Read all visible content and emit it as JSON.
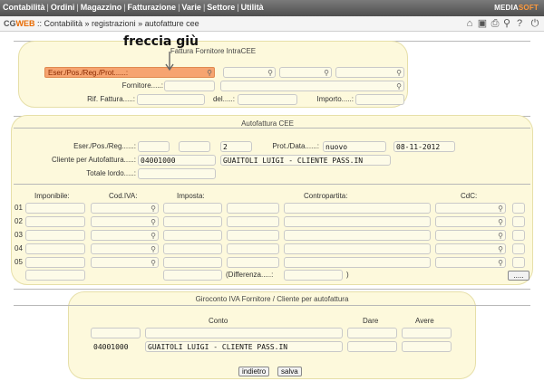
{
  "menu": [
    "Contabilità",
    "Ordini",
    "Magazzino",
    "Fatturazione",
    "Varie",
    "Settore",
    "Utilità"
  ],
  "brand": {
    "a": "MEDIA",
    "b": "SOFT"
  },
  "breadcrumb": {
    "app_a": "CG",
    "app_b": "WEB",
    "path": ":: Contabilità » registrazioni » autofatture cee"
  },
  "annotation": {
    "text": "freccia giù"
  },
  "section1": {
    "title": "Fattura Fornitore IntraCEE",
    "eser_label": "Eser./Pos./Reg./Prot......:",
    "fornitore_label": "Fornitore.....:",
    "rif_label": "Rif. Fattura.....:",
    "del_label": "del.....:",
    "importo_label": "Importo.....:"
  },
  "section2": {
    "title": "Autofattura CEE",
    "eser_label": "Eser./Pos./Reg......:",
    "reg_value": "2",
    "prot_label": "Prot./Data......:",
    "prot_value": "nuovo",
    "date_value": "08-11-2012",
    "cliente_label": "Cliente per Autofattura.....:",
    "cliente_code": "04001000",
    "cliente_name": "GUAITOLI LUIGI - CLIENTE PASS.IN",
    "totale_label": "Totale lordo.....:"
  },
  "grid": {
    "headers": {
      "imponibile": "Imponibile:",
      "cod_iva": "Cod.IVA:",
      "imposta": "Imposta:",
      "contropartita": "Contropartita:",
      "cdc": "CdC:"
    },
    "rows": [
      "01",
      "02",
      "03",
      "04",
      "05"
    ],
    "differenza_label": "(Differenza.....:",
    "paren_close": ")",
    "more_button": "....."
  },
  "section3": {
    "title": "Giroconto IVA Fornitore / Cliente per autofattura",
    "conto_label": "Conto",
    "dare_label": "Dare",
    "avere_label": "Avere",
    "conto_code": "04001000",
    "conto_name": "GUAITOLI LUIGI - CLIENTE PASS.IN"
  },
  "buttons": {
    "back": "indietro",
    "save": "salva"
  }
}
